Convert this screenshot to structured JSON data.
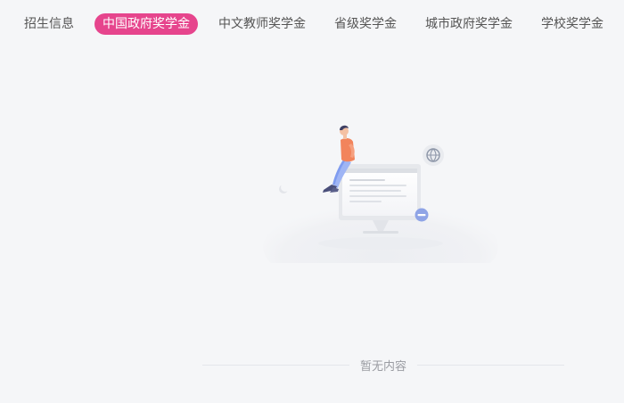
{
  "tabs": [
    {
      "label": "招生信息",
      "active": false
    },
    {
      "label": "中国政府奖学金",
      "active": true
    },
    {
      "label": "中文教师奖学金",
      "active": false
    },
    {
      "label": "省级奖学金",
      "active": false
    },
    {
      "label": "城市政府奖学金",
      "active": false
    },
    {
      "label": "学校奖学金",
      "active": false
    }
  ],
  "colors": {
    "accent": "#e6458d",
    "background": "#f5f6f8",
    "tab_text": "#555555",
    "empty_text": "#9a9ca2"
  },
  "empty_state": {
    "text": "暂无内容",
    "illustration": "person-sitting-on-monitor-empty-illustration"
  }
}
